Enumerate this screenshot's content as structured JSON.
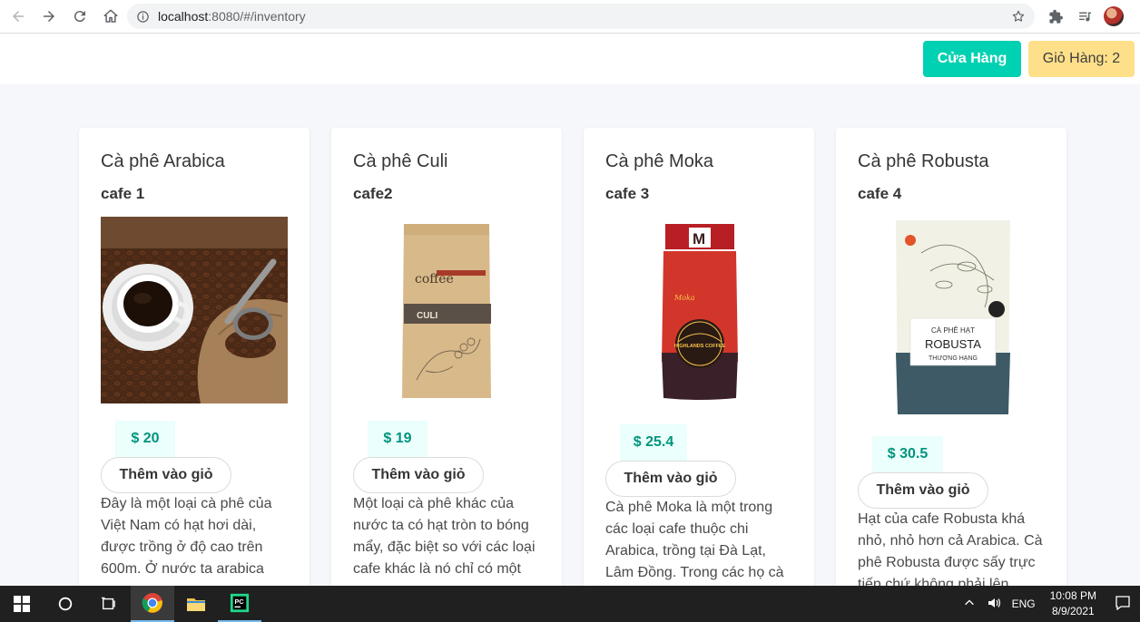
{
  "browser": {
    "url_host": "localhost",
    "url_path": ":8080/#/inventory"
  },
  "header": {
    "store_label": "Cửa Hàng",
    "cart_label": "Giỏ Hàng: 2"
  },
  "products": [
    {
      "name": "Cà phê Arabica",
      "code": "cafe 1",
      "price": "$ 20",
      "add_label": "Thêm vào giỏ",
      "description": "Đây là một loại cà phê của Việt Nam có hạt hơi dài, được trồng ở độ cao trên 600m. Ở nước ta arabica"
    },
    {
      "name": "Cà phê Culi",
      "code": "cafe2",
      "price": "$ 19",
      "add_label": "Thêm vào giỏ",
      "description": "Một loại cà phê khác của nước ta có hạt tròn to bóng mẩy, đặc biệt so với các loại cafe khác là nó chỉ có một",
      "package_brand": "coffee",
      "package_label": "CULI"
    },
    {
      "name": "Cà phê Moka",
      "code": "cafe 3",
      "price": "$ 25.4",
      "add_label": "Thêm vào giỏ",
      "description": "Cà phê Moka là một trong các loại cafe thuộc chi Arabica, trồng tại Đà Lạt, Lâm Đồng. Trong các họ cà",
      "package_letter": "M",
      "package_label": "Moka",
      "package_brand": "HIGHLANDS COFFEE"
    },
    {
      "name": "Cà phê Robusta",
      "code": "cafe 4",
      "price": "$ 30.5",
      "add_label": "Thêm vào giỏ",
      "description": "Hạt của cafe Robusta khá nhỏ, nhỏ hơn cả Arabica. Cà phê Robusta được sấy trực tiếp chứ không phải lên",
      "package_line1": "CÀ PHÊ HẠT",
      "package_line2": "ROBUSTA",
      "package_line3": "THƯỢNG HẠNG"
    }
  ],
  "taskbar": {
    "language": "ENG",
    "time": "10:08 PM",
    "date": "8/9/2021"
  },
  "colors": {
    "primary": "#00d1b2",
    "warning": "#ffe08a",
    "price_text": "#00947e",
    "price_bg": "#ebfffc"
  }
}
